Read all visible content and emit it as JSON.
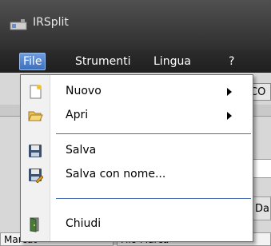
{
  "window": {
    "title": "IRSplit"
  },
  "menubar": {
    "items": [
      "File",
      "Strumenti",
      "Lingua",
      "?"
    ]
  },
  "file_menu": {
    "items": [
      {
        "label": "Nuovo",
        "icon": "new-document-icon",
        "submenu": true
      },
      {
        "label": "Apri",
        "icon": "open-folder-icon",
        "submenu": true
      },
      {
        "label": "Salva",
        "icon": "floppy-save-icon",
        "submenu": false
      },
      {
        "label": "Salva con nome...",
        "icon": "floppy-save-as-icon",
        "submenu": false
      },
      {
        "label": "Chiudi",
        "icon": "exit-door-icon",
        "submenu": false
      }
    ]
  },
  "background": {
    "tab_label": "CO",
    "column_header": "Da",
    "cells": [
      "Marcat",
      "Filo Marca"
    ]
  },
  "colors": {
    "titlebar": "#3c3c3c",
    "menu_highlight": "#4f82d0",
    "separator": "#4a6fb0"
  }
}
